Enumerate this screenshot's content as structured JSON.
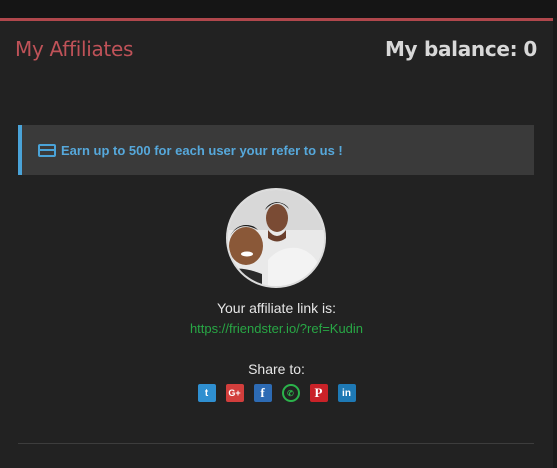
{
  "header": {
    "title": "My Affiliates",
    "balance_label": "My balance:",
    "balance_value": "0"
  },
  "alert": {
    "icon": "credit-card-icon",
    "text": "Earn up to 500 for each user your refer to us !"
  },
  "affiliate": {
    "link_label": "Your affiliate link is:",
    "link_url": "https://friendster.io/?ref=Kudin"
  },
  "share": {
    "label": "Share to:",
    "icons": [
      {
        "name": "twitter-icon",
        "glyph": "t",
        "color": "#2f8fd0"
      },
      {
        "name": "google-plus-icon",
        "glyph": "G+",
        "color": "#d23e3c"
      },
      {
        "name": "facebook-icon",
        "glyph": "f",
        "color": "#2d6bb4"
      },
      {
        "name": "whatsapp-icon",
        "glyph": "✆",
        "color": "#2bb34b"
      },
      {
        "name": "pinterest-icon",
        "glyph": "P",
        "color": "#c92228"
      },
      {
        "name": "linkedin-icon",
        "glyph": "in",
        "color": "#1e79b5"
      }
    ]
  },
  "colors": {
    "accent": "#b0474c",
    "info": "#4aa3d8",
    "link": "#28a745",
    "panel_bg": "#222222"
  }
}
